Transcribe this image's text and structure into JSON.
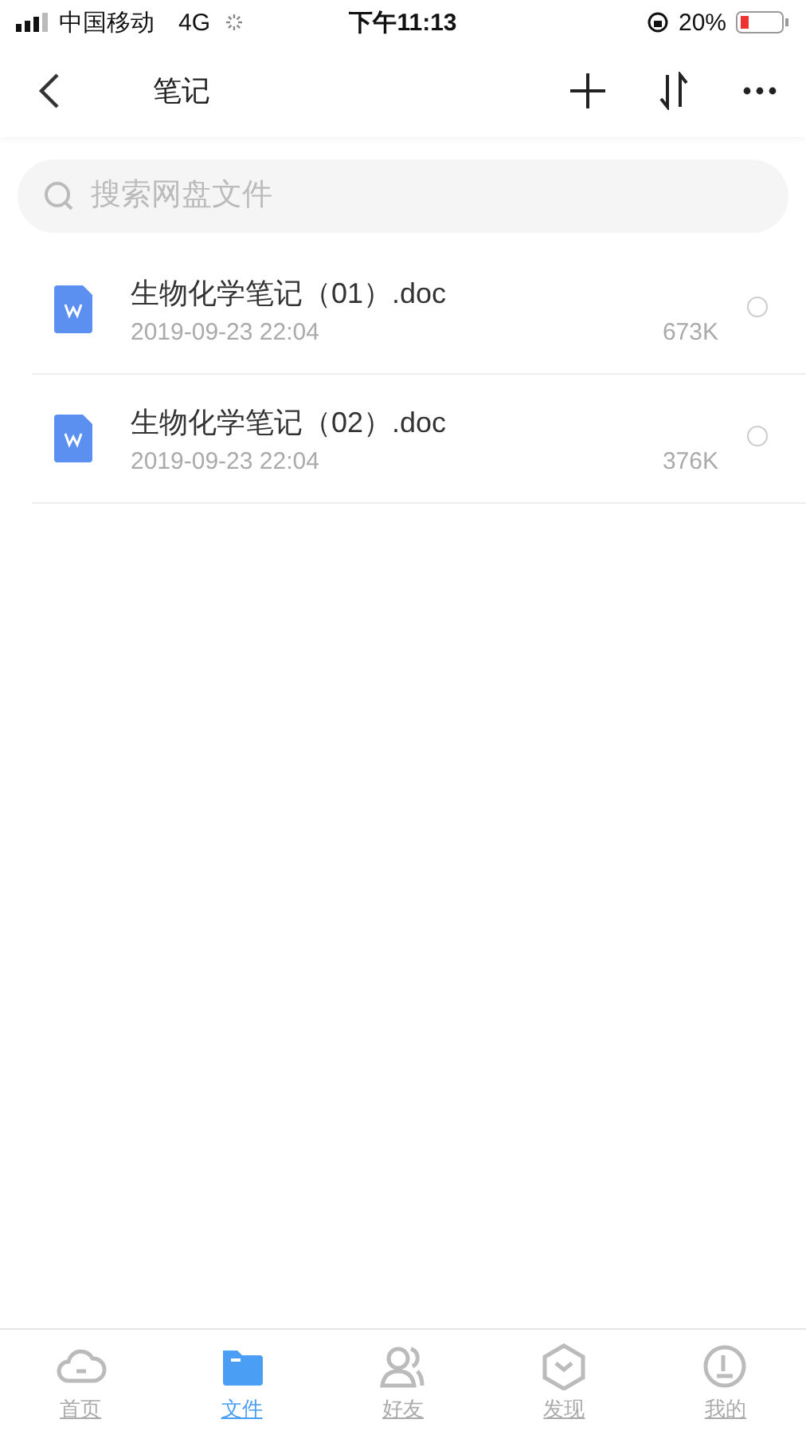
{
  "status_bar": {
    "carrier": "中国移动",
    "network": "4G",
    "time": "下午11:13",
    "battery": "20%"
  },
  "header": {
    "title": "笔记"
  },
  "search": {
    "placeholder": "搜索网盘文件"
  },
  "files": [
    {
      "name": "生物化学笔记（01）.doc",
      "date": "2019-09-23 22:04",
      "size": "673K",
      "selected": false
    },
    {
      "name": "生物化学笔记（02）.doc",
      "date": "2019-09-23 22:04",
      "size": "376K",
      "selected": false
    }
  ],
  "tab_bar": [
    {
      "kind": "home",
      "label": "首页",
      "selected": false
    },
    {
      "kind": "files",
      "label": "文件",
      "selected": true
    },
    {
      "kind": "friends",
      "label": "好友",
      "selected": false
    },
    {
      "kind": "discover",
      "label": "发现",
      "selected": false
    },
    {
      "kind": "me",
      "label": "我的",
      "selected": false
    }
  ]
}
